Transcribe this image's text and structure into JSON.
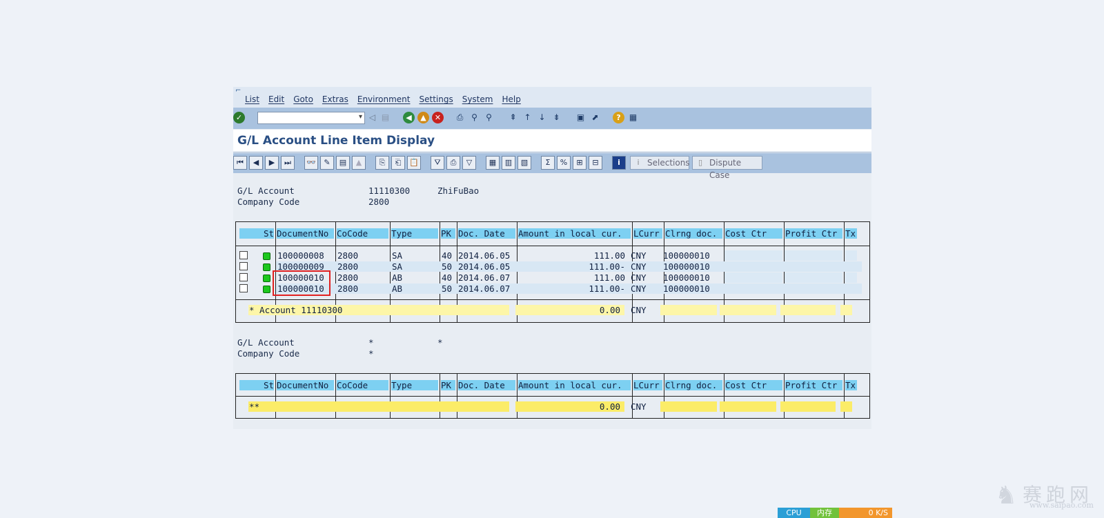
{
  "menubar": {
    "items": [
      "List",
      "Edit",
      "Goto",
      "Extras",
      "Environment",
      "Settings",
      "System",
      "Help"
    ]
  },
  "toolbar1": {
    "command_value": ""
  },
  "page_title": "G/L Account Line Item Display",
  "toolbar2": {
    "selections_label": "Selections",
    "dispute_label": "Dispute Case"
  },
  "header1": {
    "gl_label": "G/L Account",
    "gl_value": "11110300",
    "gl_name": "ZhiFuBao",
    "cc_label": "Company Code",
    "cc_value": "2800"
  },
  "columns": [
    "St",
    "DocumentNo",
    "CoCode",
    "Type",
    "PK",
    "Doc. Date",
    "Amount in local cur.",
    "LCurr",
    "Clrng doc.",
    "Cost Ctr",
    "Profit Ctr",
    "Tx"
  ],
  "rows": [
    {
      "doc": "100000008",
      "cocode": "2800",
      "type": "SA",
      "pk": "40",
      "date": "2014.06.05",
      "amount": "111.00",
      "curr": "CNY",
      "clrng": "100000010"
    },
    {
      "doc": "100000009",
      "cocode": "2800",
      "type": "SA",
      "pk": "50",
      "date": "2014.06.05",
      "amount": "111.00-",
      "curr": "CNY",
      "clrng": "100000010"
    },
    {
      "doc": "100000010",
      "cocode": "2800",
      "type": "AB",
      "pk": "40",
      "date": "2014.06.07",
      "amount": "111.00",
      "curr": "CNY",
      "clrng": "100000010"
    },
    {
      "doc": "100000010",
      "cocode": "2800",
      "type": "AB",
      "pk": "50",
      "date": "2014.06.07",
      "amount": "111.00-",
      "curr": "CNY",
      "clrng": "100000010"
    }
  ],
  "subtotal": {
    "label": "* Account 11110300",
    "amount": "0.00",
    "curr": "CNY"
  },
  "header2": {
    "gl_label": "G/L Account",
    "gl_value": "*",
    "gl_name": "*",
    "cc_label": "Company Code",
    "cc_value": "*"
  },
  "total": {
    "label": "**",
    "amount": "0.00",
    "curr": "CNY"
  },
  "statusbar": {
    "cpu": "CPU",
    "mem": "内存",
    "net": "0 K/S"
  },
  "watermark": {
    "big": "赛跑网",
    "small": "www.saipao.com"
  },
  "colors": {
    "header_cyan": "#7dd0f2",
    "subtotal_yellow": "#fdf6a8",
    "total_yellow": "#fbec68",
    "highlight_red": "#e02020",
    "led_green": "#1ec81e"
  }
}
